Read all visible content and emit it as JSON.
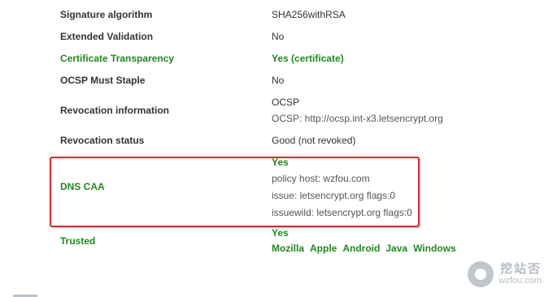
{
  "rows": {
    "signature_algorithm": {
      "label": "Signature algorithm",
      "value": "SHA256withRSA"
    },
    "extended_validation": {
      "label": "Extended Validation",
      "value": "No"
    },
    "certificate_transparency": {
      "label": "Certificate Transparency",
      "value": "Yes (certificate)"
    },
    "ocsp_must_staple": {
      "label": "OCSP Must Staple",
      "value": "No"
    },
    "revocation_information": {
      "label": "Revocation information",
      "value_line1": "OCSP",
      "value_line2": "OCSP: http://ocsp.int-x3.letsencrypt.org"
    },
    "revocation_status": {
      "label": "Revocation status",
      "value": "Good (not revoked)"
    },
    "dns_caa": {
      "label": "DNS CAA",
      "status": "Yes",
      "lines": [
        "policy host: wzfou.com",
        "issue: letsencrypt.org flags:0",
        "issuewild: letsencrypt.org flags:0"
      ]
    },
    "trusted": {
      "label": "Trusted",
      "status": "Yes",
      "browsers": [
        "Mozilla",
        "Apple",
        "Android",
        "Java",
        "Windows"
      ]
    }
  },
  "watermark": {
    "cn": "挖站否",
    "en": "wzfou.com",
    "icon": "wzfou-logo"
  },
  "colors": {
    "green": "#1e8a1e",
    "highlight_border": "#d92b2b",
    "text": "#333333"
  }
}
